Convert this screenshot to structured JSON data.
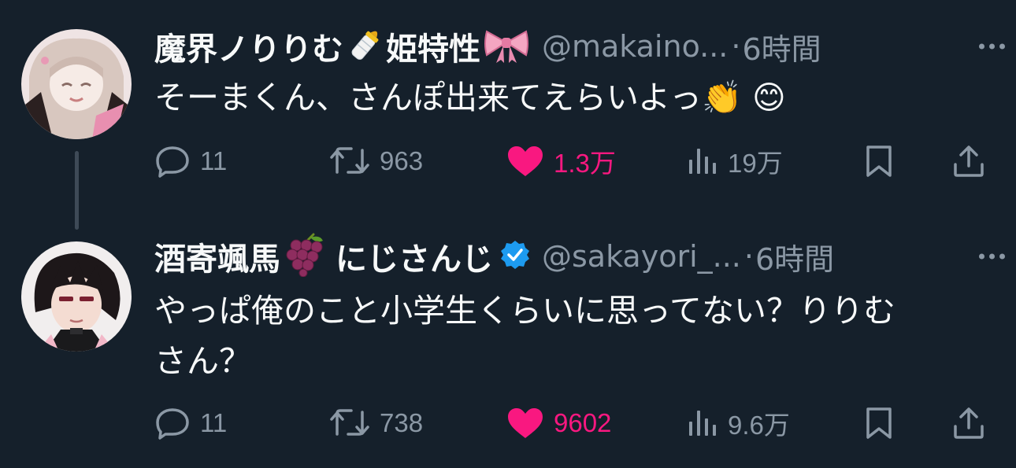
{
  "tweets": [
    {
      "name": "魔界ノりりむ",
      "name_emoji_1": "baby-bottle",
      "name_suffix": "姫特性",
      "name_emoji_2": "ribbon",
      "handle": "@makaino...",
      "dot": "·",
      "time": "6時間",
      "text": "そーまくん、さんぽ出来てえらいよっ👏 😊",
      "actions": {
        "replies": "11",
        "retweets": "963",
        "likes": "1.3万",
        "views": "19万"
      }
    },
    {
      "name": "酒寄颯馬",
      "name_emoji_1": "grapes",
      "name_suffix": "にじさんじ",
      "verified": true,
      "handle": "@sakayori_...",
      "dot": "·",
      "time": "6時間",
      "text_line1": "やっぱ俺のこと小学生くらいに思ってない？りりむ",
      "text_line2": "さん？",
      "actions": {
        "replies": "11",
        "retweets": "738",
        "likes": "9602",
        "views": "9.6万"
      }
    }
  ],
  "colors": {
    "background": "#15202b",
    "text": "#f7f9f9",
    "muted": "#8b98a5",
    "like": "#f91880",
    "verified": "#1d9bf0"
  }
}
